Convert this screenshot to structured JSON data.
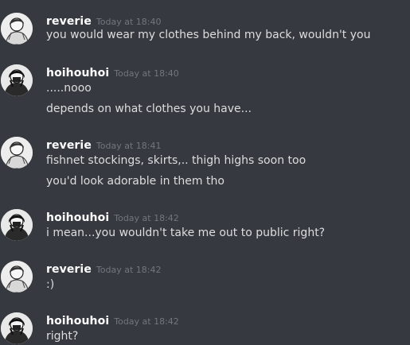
{
  "colors": {
    "background": "#36393f",
    "username": "#ffffff",
    "timestamp": "#72767d",
    "text": "#dcddde"
  },
  "messages": [
    {
      "author": "reverie",
      "time": "Today at 18:40",
      "avatar_icon": "user-avatar-icon",
      "lines": [
        "you would wear my clothes behind my back, wouldn't you"
      ]
    },
    {
      "author": "hoihouhoi",
      "time": "Today at 18:40",
      "avatar_icon": "user-avatar-icon",
      "lines": [
        ".....nooo",
        "depends on what clothes you have..."
      ]
    },
    {
      "author": "reverie",
      "time": "Today at 18:41",
      "avatar_icon": "user-avatar-icon",
      "lines": [
        "fishnet stockings, skirts,.. thigh highs soon too",
        "you'd look adorable in them tho"
      ]
    },
    {
      "author": "hoihouhoi",
      "time": "Today at 18:42",
      "avatar_icon": "user-avatar-icon",
      "lines": [
        "i mean...you wouldn't take me out to public right?"
      ]
    },
    {
      "author": "reverie",
      "time": "Today at 18:42",
      "avatar_icon": "user-avatar-icon",
      "lines": [
        ":)"
      ]
    },
    {
      "author": "hoihouhoi",
      "time": "Today at 18:42",
      "avatar_icon": "user-avatar-icon",
      "lines": [
        "right?"
      ]
    }
  ]
}
